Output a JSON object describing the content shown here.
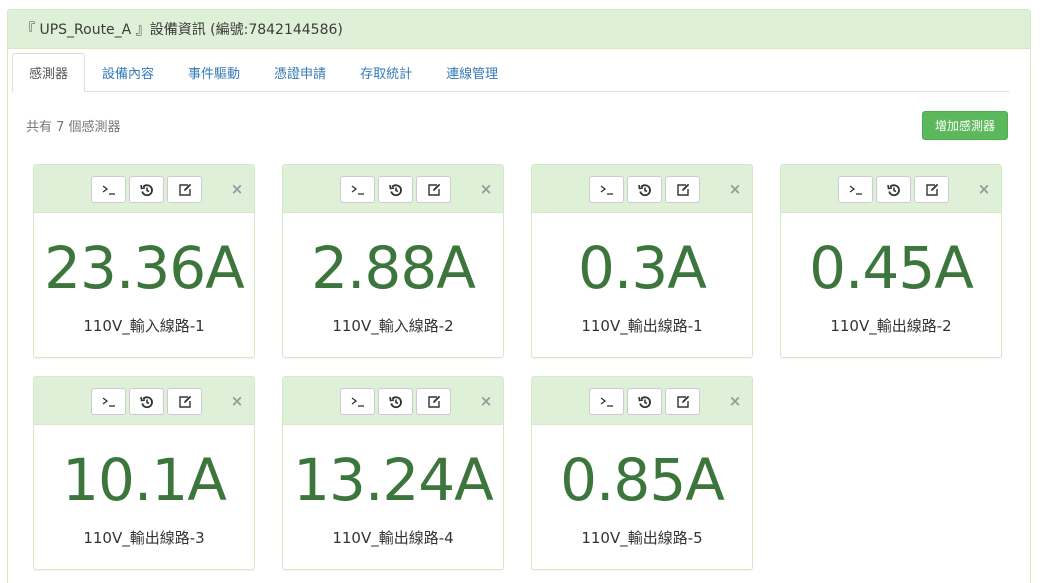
{
  "header": {
    "title": "『 UPS_Route_A 』設備資訊 (編號:7842144586)"
  },
  "tabs": [
    {
      "label": "感測器",
      "active": true
    },
    {
      "label": "設備內容",
      "active": false
    },
    {
      "label": "事件驅動",
      "active": false
    },
    {
      "label": "憑證申請",
      "active": false
    },
    {
      "label": "存取統計",
      "active": false
    },
    {
      "label": "連線管理",
      "active": false
    }
  ],
  "sensors_summary": "共有 7 個感測器",
  "add_button_label": "增加感測器",
  "close_glyph": "×",
  "colors": {
    "panel_bg": "#dff0d8",
    "value_text": "#3d763d",
    "button": "#5cb85c",
    "link": "#337ab7"
  },
  "sensors": [
    {
      "value": "23.36A",
      "name": "110V_輸入線路-1"
    },
    {
      "value": "2.88A",
      "name": "110V_輸入線路-2"
    },
    {
      "value": "0.3A",
      "name": "110V_輸出線路-1"
    },
    {
      "value": "0.45A",
      "name": "110V_輸出線路-2"
    },
    {
      "value": "10.1A",
      "name": "110V_輸出線路-3"
    },
    {
      "value": "13.24A",
      "name": "110V_輸出線路-4"
    },
    {
      "value": "0.85A",
      "name": "110V_輸出線路-5"
    }
  ],
  "icons": {
    "console": "terminal-icon",
    "history": "history-icon",
    "edit": "edit-icon",
    "remove": "close-icon"
  }
}
